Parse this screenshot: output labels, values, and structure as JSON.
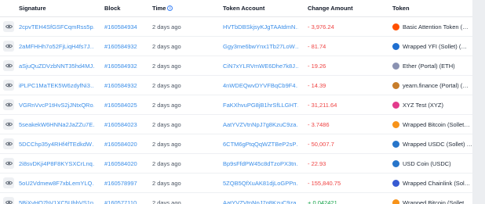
{
  "columns": {
    "signature": "Signature",
    "block": "Block",
    "time": "Time",
    "account": "Token Account",
    "amount": "Change Amount",
    "token": "Token"
  },
  "rows": [
    {
      "signature": "2cpvTEH4SfGSFCqmRss5p…",
      "block": "#160584934",
      "time": "2 days ago",
      "account": "HVTbDBSkjsyKJgTAAtdmN…",
      "amount": "- 3,976.24",
      "token": "Basic Attention Token (…",
      "token_color": "#ff5000"
    },
    {
      "signature": "2aMFHHh7o52FjLiqH4fs7J…",
      "block": "#160584932",
      "time": "2 days ago",
      "account": "Ggy3me6bwYnx1Tb27LoW…",
      "amount": "- 81.74",
      "token": "Wrapped YFI (Sollet) (…",
      "token_color": "#1f6fd0"
    },
    {
      "signature": "aSjuQuZDVzbNNT35hd4MJ…",
      "block": "#160584932",
      "time": "2 days ago",
      "account": "CiN7xYLRVmWE6Dhe7k8J…",
      "amount": "- 19.26",
      "token": "Ether (Portal) (ETH)",
      "token_color": "#8a92b2"
    },
    {
      "signature": "iPLPC1MaTEK5W6zdyfNi3…",
      "block": "#160584932",
      "time": "2 days ago",
      "account": "4nWDEQwvDYVFBqCb9F4…",
      "amount": "- 14.39",
      "token": "yearn.finance (Portal) (…",
      "token_color": "#c77d2a"
    },
    {
      "signature": "VGRnVvcP1tHvS2jJNtxQRo…",
      "block": "#160584025",
      "time": "2 days ago",
      "account": "FaKXhvuPG8jB1hrSfLLGHT…",
      "amount": "- 31,211.64",
      "token": "XYZ Test (XYZ)",
      "token_color": "#e33a8c"
    },
    {
      "signature": "5seakekW6HNNa2JaZZu7E…",
      "block": "#160584023",
      "time": "2 days ago",
      "account": "AatYVZVtnNpJ7g8KzuC9za…",
      "amount": "- 3.7486",
      "token": "Wrapped Bitcoin (Sollet…",
      "token_color": "#f7931a"
    },
    {
      "signature": "5DCChp35y4RHf4fTEdkdW…",
      "block": "#160584020",
      "time": "2 days ago",
      "account": "6CTM6gPtqQqWZTBeP2sP…",
      "amount": "- 50,007.7",
      "token": "Wrapped USDC (Sollet) …",
      "token_color": "#2775ca"
    },
    {
      "signature": "2i8svDKji4P8F8KYSXCrLnq…",
      "block": "#160584020",
      "time": "2 days ago",
      "account": "Bp9sFfdPW45c8dTzoPX3tn…",
      "amount": "- 22.93",
      "token": "USD Coin (USDC)",
      "token_color": "#2775ca"
    },
    {
      "signature": "5oU2Vdmew8F7xbLemYLQ…",
      "block": "#160578997",
      "time": "2 days ago",
      "account": "5ZQB5QfXuAK81djLoGPPn…",
      "amount": "- 155,840.75",
      "token": "Wrapped Chainlink (Sol…",
      "token_color": "#375bd2"
    },
    {
      "signature": "5BjXvHQ7bV1XC5UhbVS1n…",
      "block": "#160577110",
      "time": "2 days ago",
      "account": "AatYVZVtnNpJ7g8KzuC9za…",
      "amount": "+ 0.042421",
      "token": "Wrapped Bitcoin (Sollet…",
      "token_color": "#f7931a"
    }
  ]
}
